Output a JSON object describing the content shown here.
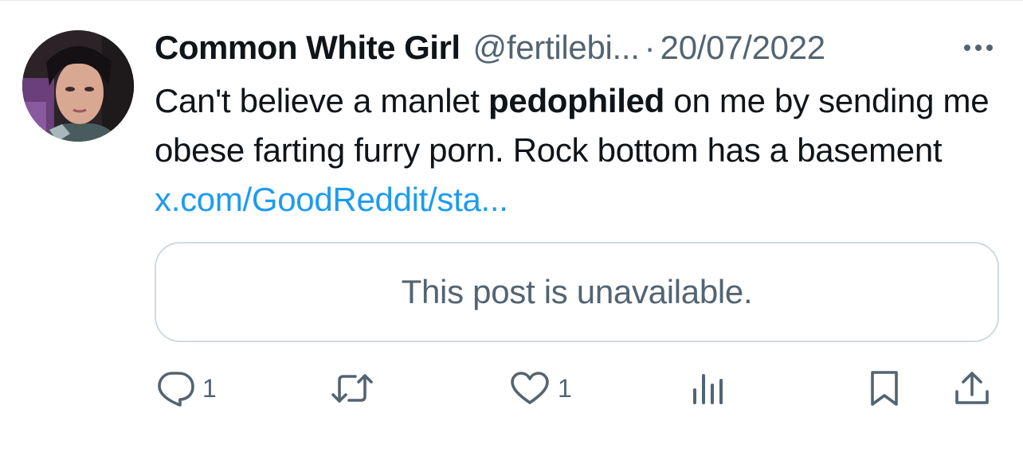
{
  "tweet": {
    "display_name": "Common White Girl",
    "handle": "@fertilebi...",
    "separator": "·",
    "date": "20/07/2022",
    "text_parts": {
      "part1": "Can't believe a manlet ",
      "bold": "pedophiled",
      "part2": " on me by sending me obese farting furry porn. Rock bottom has a basement ",
      "link": "x.com/GoodReddit/sta..."
    },
    "quote_card_text": "This post is unavailable."
  },
  "actions": {
    "reply_count": "1",
    "like_count": "1"
  },
  "icons": {
    "more": "more-icon",
    "reply": "reply-icon",
    "retweet": "retweet-icon",
    "like": "heart-icon",
    "views": "views-icon",
    "bookmark": "bookmark-icon",
    "share": "share-icon"
  },
  "colors": {
    "text": "#0f1419",
    "secondary": "#536471",
    "link": "#1d9bf0",
    "border": "#cfd9de"
  }
}
